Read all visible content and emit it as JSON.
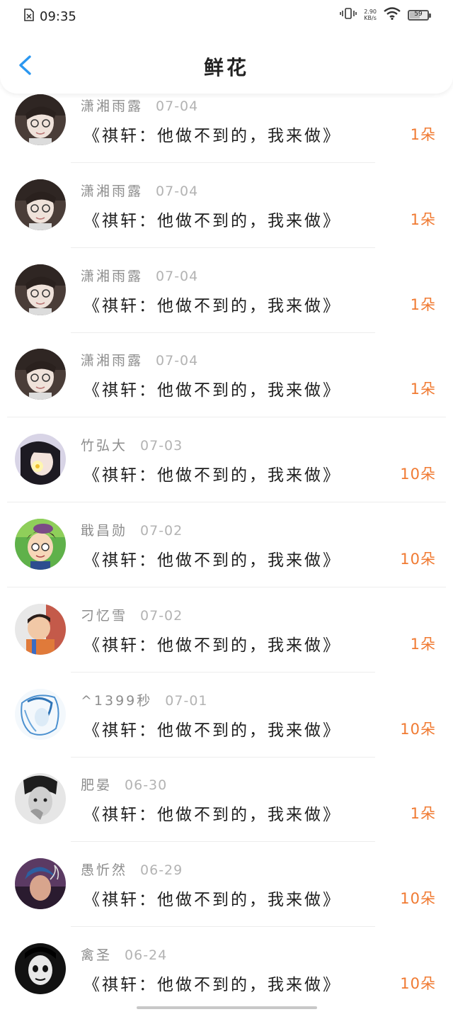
{
  "status": {
    "time": "09:35",
    "net_speed_value": "2.90",
    "net_speed_unit": "KB/s",
    "battery": "59"
  },
  "header": {
    "title": "鲜花"
  },
  "colors": {
    "accent_blue": "#2b97f0",
    "amount_orange": "#f07a32"
  },
  "items": [
    {
      "name": "潇湘雨露",
      "date": "07-04",
      "title": "《祺轩：他做不到的，我来做》",
      "amount": "1朵",
      "avatar": "avatar-boy-glasses"
    },
    {
      "name": "潇湘雨露",
      "date": "07-04",
      "title": "《祺轩：他做不到的，我来做》",
      "amount": "1朵",
      "avatar": "avatar-boy-glasses"
    },
    {
      "name": "潇湘雨露",
      "date": "07-04",
      "title": "《祺轩：他做不到的，我来做》",
      "amount": "1朵",
      "avatar": "avatar-boy-glasses"
    },
    {
      "name": "潇湘雨露",
      "date": "07-04",
      "title": "《祺轩：他做不到的，我来做》",
      "amount": "1朵",
      "avatar": "avatar-boy-glasses"
    },
    {
      "name": "竹弘大",
      "date": "07-03",
      "title": "《祺轩：他做不到的，我来做》",
      "amount": "10朵",
      "avatar": "avatar-girl-flower"
    },
    {
      "name": "戢昌勋",
      "date": "07-02",
      "title": "《祺轩：他做不到的，我来做》",
      "amount": "10朵",
      "avatar": "avatar-cartoon-detective"
    },
    {
      "name": "刁忆雪",
      "date": "07-02",
      "title": "《祺轩：他做不到的，我来做》",
      "amount": "1朵",
      "avatar": "avatar-child"
    },
    {
      "name": "^1399秒",
      "date": "07-01",
      "title": "《祺轩：他做不到的，我来做》",
      "amount": "10朵",
      "avatar": "avatar-blue-sketch"
    },
    {
      "name": "肥晏",
      "date": "06-30",
      "title": "《祺轩：他做不到的，我来做》",
      "amount": "1朵",
      "avatar": "avatar-bw-portrait"
    },
    {
      "name": "愚忻然",
      "date": "06-29",
      "title": "《祺轩：他做不到的，我来做》",
      "amount": "10朵",
      "avatar": "avatar-smoke"
    },
    {
      "name": "禽圣",
      "date": "06-24",
      "title": "《祺轩：他做不到的，我来做》",
      "amount": "10朵",
      "avatar": "avatar-dark-face"
    }
  ]
}
